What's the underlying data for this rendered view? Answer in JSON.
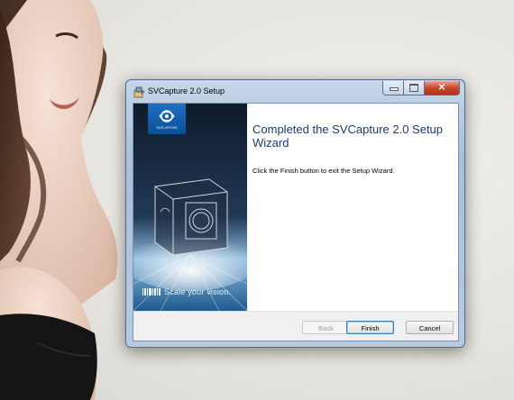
{
  "window": {
    "title": "SVCapture 2.0 Setup"
  },
  "banner": {
    "logo_text": "SVS-VISTEK",
    "tagline": "Scale your vision."
  },
  "content": {
    "heading": "Completed the SVCapture 2.0 Setup Wizard",
    "body": "Click the Finish button to exit the Setup Wizard."
  },
  "buttons": {
    "back": "Back",
    "finish": "Finish",
    "cancel": "Cancel"
  },
  "icons": {
    "installer": "installer-icon",
    "minimize": "minimize-icon",
    "maximize": "maximize-icon",
    "close": "close-icon",
    "logo": "eye-logo-icon",
    "camera": "camera-illustration"
  },
  "colors": {
    "heading": "#1e3a6b",
    "banner_top": "#0e1a2a",
    "banner_bottom": "#1d5a8e",
    "close_button": "#c8482c"
  }
}
